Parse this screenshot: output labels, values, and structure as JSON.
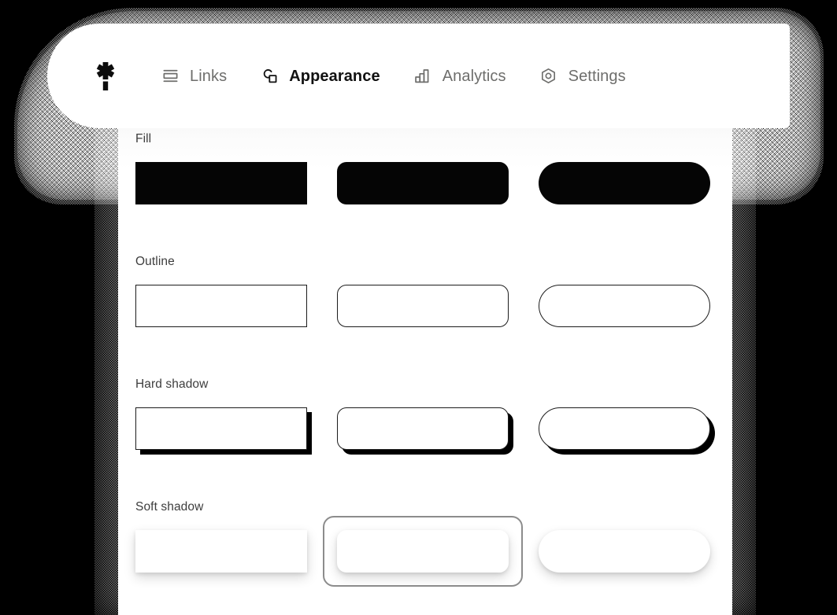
{
  "app": {
    "logo_icon": "asterisk-logo-icon",
    "background_color": "#000000",
    "panel_color": "#ffffff"
  },
  "nav": {
    "items": [
      {
        "label": "Links",
        "icon": "links-card-icon",
        "active": false
      },
      {
        "label": "Appearance",
        "icon": "shapes-icon",
        "active": true
      },
      {
        "label": "Analytics",
        "icon": "bar-chart-icon",
        "active": false
      },
      {
        "label": "Settings",
        "icon": "hex-nut-icon",
        "active": false
      }
    ],
    "active_label": "Appearance",
    "active_color": "#111111",
    "inactive_color": "#6e6e6c"
  },
  "appearance": {
    "sections": [
      {
        "id": "fill",
        "label": "Fill",
        "swatches": [
          {
            "shape": "square",
            "style": "fill",
            "selected": false
          },
          {
            "shape": "rounded",
            "style": "fill",
            "selected": false
          },
          {
            "shape": "pill",
            "style": "fill",
            "selected": false
          }
        ]
      },
      {
        "id": "outline",
        "label": "Outline",
        "swatches": [
          {
            "shape": "square",
            "style": "outline",
            "selected": false
          },
          {
            "shape": "rounded",
            "style": "outline",
            "selected": false
          },
          {
            "shape": "pill",
            "style": "outline",
            "selected": false
          }
        ]
      },
      {
        "id": "hard-shadow",
        "label": "Hard shadow",
        "swatches": [
          {
            "shape": "square",
            "style": "hard-shadow",
            "selected": false
          },
          {
            "shape": "rounded",
            "style": "hard-shadow",
            "selected": false
          },
          {
            "shape": "pill",
            "style": "hard-shadow",
            "selected": false
          }
        ]
      },
      {
        "id": "soft-shadow",
        "label": "Soft shadow",
        "swatches": [
          {
            "shape": "square",
            "style": "soft-shadow",
            "selected": false
          },
          {
            "shape": "rounded",
            "style": "soft-shadow",
            "selected": true
          },
          {
            "shape": "pill",
            "style": "soft-shadow",
            "selected": false
          }
        ]
      }
    ],
    "selection_ring_color": "#8c8c8c",
    "fill_color": "#050505",
    "outline_color": "#1c1c1c"
  }
}
